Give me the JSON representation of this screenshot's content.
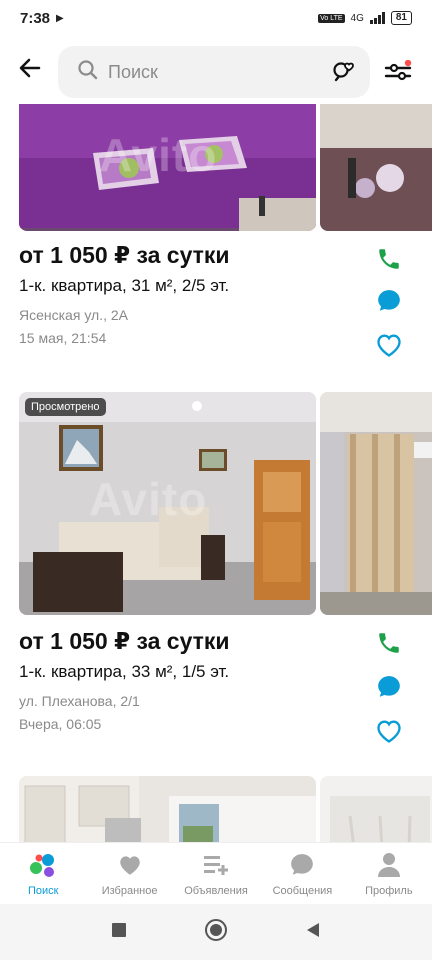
{
  "status_bar": {
    "time": "7:38",
    "battery": "81",
    "network": "4G"
  },
  "search": {
    "placeholder": "Поиск"
  },
  "listings": [
    {
      "price": "от 1 050 ₽ за сутки",
      "title": "1-к. квартира, 31 м², 2/5 эт.",
      "address": "Ясенская ул., 2А",
      "date": "15 мая, 21:54",
      "badge": ""
    },
    {
      "price": "от 1 050 ₽ за сутки",
      "title": "1-к. квартира, 33 м², 1/5 эт.",
      "address": "ул. Плеханова, 2/1",
      "date": "Вчера, 06:05",
      "badge": "Просмотрено"
    }
  ],
  "watermark": "Avito",
  "tabs": [
    {
      "label": "Поиск",
      "icon": "search-dots-icon",
      "active": true
    },
    {
      "label": "Избранное",
      "icon": "heart-icon",
      "active": false
    },
    {
      "label": "Объявления",
      "icon": "listings-add-icon",
      "active": false
    },
    {
      "label": "Сообщения",
      "icon": "chat-bubble-icon",
      "active": false
    },
    {
      "label": "Профиль",
      "icon": "profile-icon",
      "active": false
    }
  ],
  "colors": {
    "accent": "#0a9cd6",
    "phone": "#1fa14a",
    "chat": "#0a9cd6",
    "heart": "#0a9cd6"
  }
}
